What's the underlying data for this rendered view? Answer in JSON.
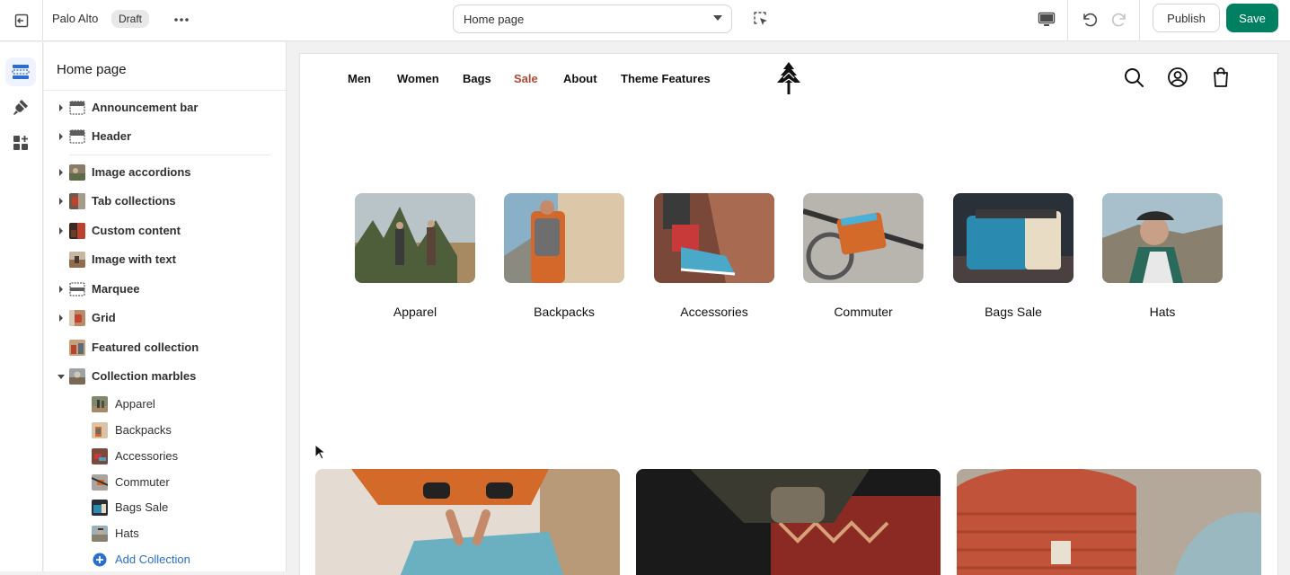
{
  "topbar": {
    "store_name": "Palo Alto",
    "status_badge": "Draft",
    "page_selector": "Home page",
    "publish_label": "Publish",
    "save_label": "Save",
    "save_color": "#008060"
  },
  "rail": {
    "items": [
      {
        "icon": "sections-icon",
        "active": true
      },
      {
        "icon": "theme-settings-icon",
        "active": false
      },
      {
        "icon": "apps-add-icon",
        "active": false
      }
    ]
  },
  "sidebar": {
    "title": "Home page",
    "header_group": [
      {
        "label": "Announcement bar",
        "icon": "announcement-bar-icon",
        "expandable": true
      },
      {
        "label": "Header",
        "icon": "header-layout-icon",
        "expandable": true
      }
    ],
    "template_group": [
      {
        "label": "Image accordions",
        "expandable": true
      },
      {
        "label": "Tab collections",
        "expandable": true
      },
      {
        "label": "Custom content",
        "expandable": true
      },
      {
        "label": "Image with text",
        "expandable": false
      },
      {
        "label": "Marquee",
        "expandable": true
      },
      {
        "label": "Grid",
        "expandable": true
      },
      {
        "label": "Featured collection",
        "expandable": false
      },
      {
        "label": "Collection marbles",
        "expandable": true,
        "expanded": true
      }
    ],
    "collection_blocks": [
      "Apparel",
      "Backpacks",
      "Accessories",
      "Commuter",
      "Bags Sale",
      "Hats"
    ],
    "add_collection_label": "Add Collection"
  },
  "preview": {
    "nav": [
      "Men",
      "Women",
      "Bags",
      "Sale",
      "About",
      "Theme Features"
    ],
    "sale_color": "#b04a34",
    "header_icons": [
      "search-icon",
      "account-icon",
      "cart-bag-icon"
    ],
    "marbles": [
      "Apparel",
      "Backpacks",
      "Accessories",
      "Commuter",
      "Bags Sale",
      "Hats"
    ]
  }
}
